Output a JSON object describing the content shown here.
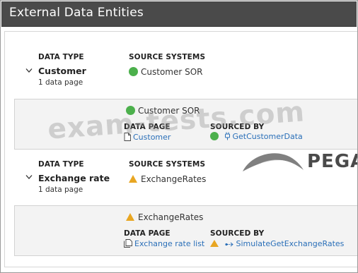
{
  "header": {
    "title": "External Data Entities"
  },
  "entities": [
    {
      "data_type_label": "DATA TYPE",
      "name": "Customer",
      "count": "1  data page",
      "source_systems_label": "SOURCE SYSTEMS",
      "source_system": "Customer SOR",
      "source_status": "green-dot",
      "detail": {
        "system": "Customer SOR",
        "data_page_label": "DATA PAGE",
        "data_page": "Customer",
        "sourced_by_label": "SOURCED BY",
        "sourced_by": "GetCustomerData"
      }
    },
    {
      "data_type_label": "DATA TYPE",
      "name": "Exchange rate",
      "count": "1  data page",
      "source_systems_label": "SOURCE SYSTEMS",
      "source_system": "ExchangeRates",
      "source_status": "warning-triangle",
      "detail": {
        "system": "ExchangeRates",
        "data_page_label": "DATA PAGE",
        "data_page": "Exchange rate list",
        "sourced_by_label": "SOURCED BY",
        "sourced_by": "SimulateGetExchangeRates"
      }
    }
  ],
  "watermark": "exam-tests.com",
  "logo": {
    "text": "PEGA"
  },
  "colors": {
    "header_bg": "#4a4a4a",
    "ok": "#4cb04c",
    "warn": "#e8a622",
    "link": "#2a6fb8"
  }
}
